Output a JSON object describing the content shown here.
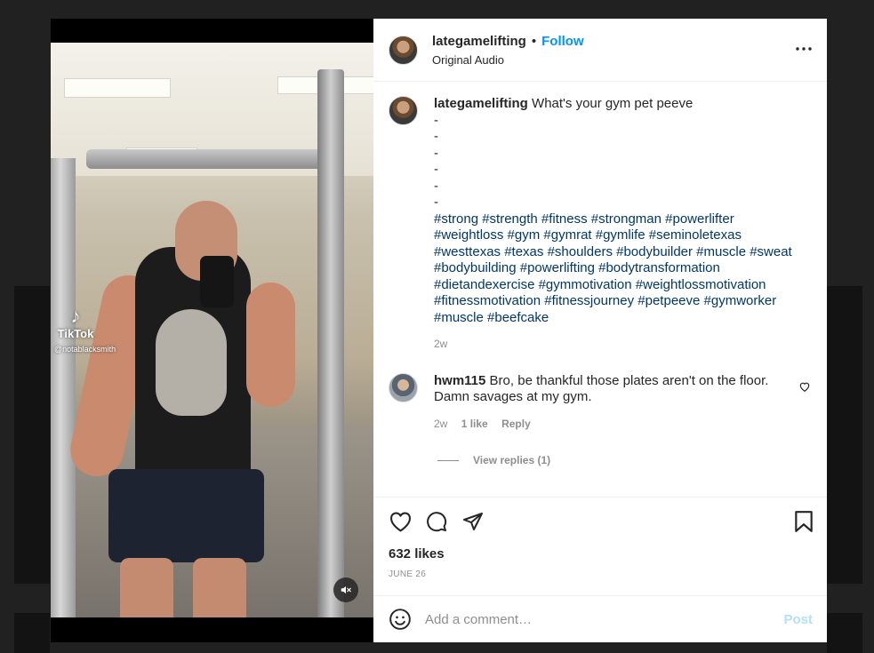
{
  "post": {
    "author": "lategamelifting",
    "follow_label": "Follow",
    "separator": "•",
    "audio": "Original Audio",
    "caption": "What's your gym pet peeve",
    "dashes": [
      "-",
      "-",
      "-",
      "-",
      "-",
      "-"
    ],
    "hashtags": "#strong #strength #fitness #strongman #powerlifter #weightloss #gym #gymrat #gymlife #seminoletexas #westtexas #texas #shoulders #bodybuilder #muscle #sweat #bodybuilding #powerlifting #bodytransformation #dietandexercise #gymmotivation #weightlossmotivation #fitnessmotivation #fitnessjourney #petpeeve #gymworker #muscle #beefcake",
    "caption_time": "2w",
    "likes": "632 likes",
    "date": "JUNE 26"
  },
  "video": {
    "watermark": "TikTok",
    "watermark_user": "@notablacksmith"
  },
  "comments": [
    {
      "user": "hwm115",
      "text": "Bro, be thankful those plates aren't on the floor. Damn savages at my gym.",
      "time": "2w",
      "likes": "1 like",
      "reply_label": "Reply",
      "view_replies": "View replies (1)"
    }
  ],
  "composer": {
    "placeholder": "Add a comment…",
    "post_label": "Post"
  },
  "icons": {
    "more": "more-options-icon",
    "like": "heart-icon",
    "comment": "comment-icon",
    "share": "share-icon",
    "save": "bookmark-icon",
    "emoji": "emoji-icon",
    "mute": "muted-speaker-icon"
  },
  "colors": {
    "accent": "#0095f6",
    "hashtag": "#00376b",
    "muted_text": "#8e8e8e",
    "post_disabled": "#b2dffc"
  }
}
